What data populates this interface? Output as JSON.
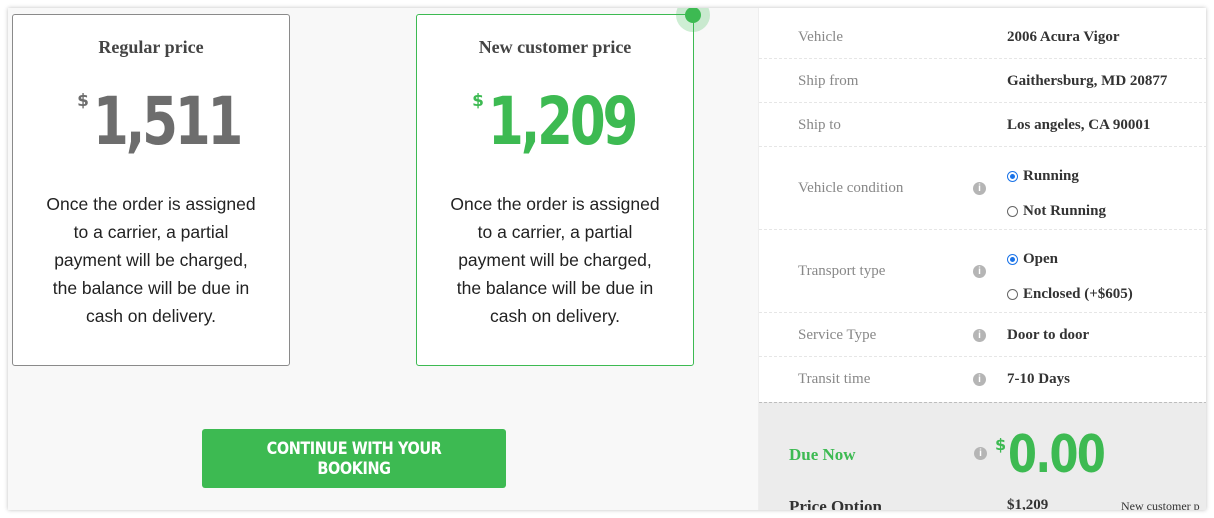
{
  "cards": {
    "regular": {
      "title": "Regular price",
      "currency": "$",
      "amount": "1,511",
      "description": "Once the order is assigned to a carrier, a partial payment will be charged, the balance will be due in cash on delivery."
    },
    "new_customer": {
      "title": "New customer price",
      "currency": "$",
      "amount": "1,209",
      "description": "Once the order is assigned to a carrier, a partial payment will be charged, the balance will be due in cash on delivery."
    }
  },
  "cta": {
    "label": "CONTINUE WITH YOUR BOOKING"
  },
  "details": {
    "vehicle": {
      "label": "Vehicle",
      "value": "2006 Acura Vigor"
    },
    "ship_from": {
      "label": "Ship from",
      "value": "Gaithersburg, MD 20877"
    },
    "ship_to": {
      "label": "Ship to",
      "value": "Los angeles, CA 90001"
    },
    "vehicle_condition": {
      "label": "Vehicle condition",
      "options": [
        {
          "label": "Running",
          "checked": true
        },
        {
          "label": "Not Running",
          "checked": false
        }
      ]
    },
    "transport_type": {
      "label": "Transport type",
      "options": [
        {
          "label": "Open",
          "checked": true
        },
        {
          "label": "Enclosed (+$605)",
          "checked": false
        }
      ]
    },
    "service_type": {
      "label": "Service Type",
      "value": "Door to door"
    },
    "transit_time": {
      "label": "Transit time",
      "value": "7-10 Days"
    }
  },
  "due": {
    "label": "Due Now",
    "currency": "$",
    "amount": "0.00",
    "price_option_label": "Price Option",
    "price_option_value": "$1,209",
    "price_option_note": "New customer p"
  },
  "icons": {
    "info": "info-icon",
    "indicator": "status-dot-icon"
  },
  "colors": {
    "accent_green": "#3dba52",
    "regular_gray": "#6d6d6d",
    "radio_blue": "#1a73e8"
  }
}
